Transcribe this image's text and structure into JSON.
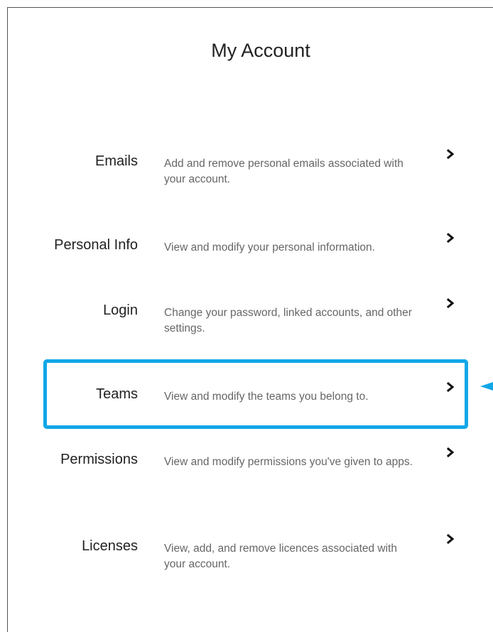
{
  "page": {
    "title": "My Account"
  },
  "rows": [
    {
      "label": "Emails",
      "description": "Add and remove personal emails associated with your account."
    },
    {
      "label": "Personal Info",
      "description": "View and modify your personal information."
    },
    {
      "label": "Login",
      "description": "Change your password, linked accounts, and other settings."
    },
    {
      "label": "Teams",
      "description": "View and modify the teams you belong to."
    },
    {
      "label": "Permissions",
      "description": "View and modify permissions you've given to apps."
    },
    {
      "label": "Licenses",
      "description": "View, add, and remove licences associated with your account."
    }
  ],
  "icons": {
    "row_chevron": "chevron-right-icon",
    "callout_arrow": "arrow-left-icon"
  },
  "colors": {
    "highlight": "#12a7e8",
    "label_text": "#222222",
    "description_text": "#666666"
  }
}
